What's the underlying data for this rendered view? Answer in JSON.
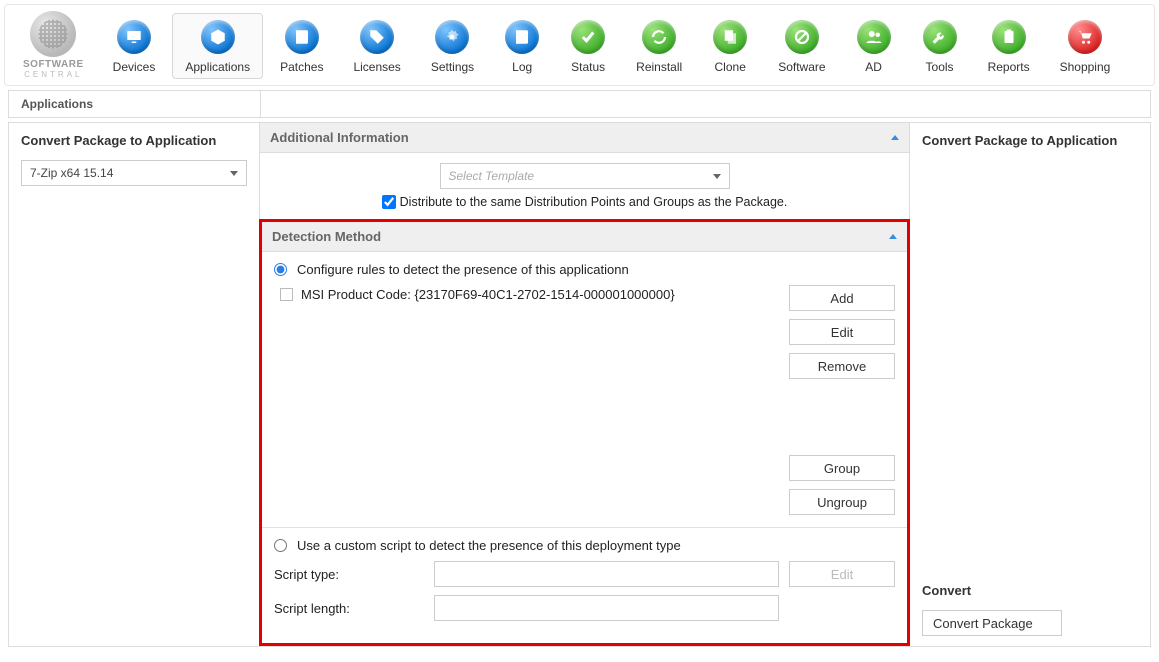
{
  "logo": {
    "brand": "SOFTWARE",
    "sub": "CENTRAL"
  },
  "toolbar": [
    {
      "id": "devices",
      "label": "Devices",
      "color": "blue",
      "glyph": "monitor"
    },
    {
      "id": "applications",
      "label": "Applications",
      "color": "blue",
      "glyph": "box",
      "active": true
    },
    {
      "id": "patches",
      "label": "Patches",
      "color": "blue",
      "glyph": "book"
    },
    {
      "id": "licenses",
      "label": "Licenses",
      "color": "blue",
      "glyph": "tag"
    },
    {
      "id": "settings",
      "label": "Settings",
      "color": "blue",
      "glyph": "gear"
    },
    {
      "id": "log",
      "label": "Log",
      "color": "blue",
      "glyph": "book"
    },
    {
      "id": "status",
      "label": "Status",
      "color": "green",
      "glyph": "check"
    },
    {
      "id": "reinstall",
      "label": "Reinstall",
      "color": "green",
      "glyph": "refresh"
    },
    {
      "id": "clone",
      "label": "Clone",
      "color": "green",
      "glyph": "copy"
    },
    {
      "id": "software",
      "label": "Software",
      "color": "green",
      "glyph": "slash"
    },
    {
      "id": "ad",
      "label": "AD",
      "color": "green",
      "glyph": "users"
    },
    {
      "id": "tools",
      "label": "Tools",
      "color": "green",
      "glyph": "wrench"
    },
    {
      "id": "reports",
      "label": "Reports",
      "color": "green",
      "glyph": "clip"
    },
    {
      "id": "shopping",
      "label": "Shopping",
      "color": "red",
      "glyph": "cart"
    }
  ],
  "breadcrumb": "Applications",
  "left": {
    "title": "Convert Package to Application",
    "package": "7-Zip x64 15.14"
  },
  "mid": {
    "additional": {
      "title": "Additional Information",
      "template_placeholder": "Select Template",
      "distribute": "Distribute to the same Distribution Points and Groups as the Package.",
      "distribute_checked": true
    },
    "detection": {
      "title": "Detection Method",
      "opt_rules": "Configure rules to detect the presence of this applicationn",
      "rules": [
        "MSI Product Code: {23170F69-40C1-2702-1514-000001000000}"
      ],
      "btn_add": "Add",
      "btn_edit": "Edit",
      "btn_remove": "Remove",
      "btn_group": "Group",
      "btn_ungroup": "Ungroup",
      "opt_script": "Use a custom script to detect the presence of this deployment type",
      "script_type_label": "Script type:",
      "script_type": "",
      "script_length_label": "Script length:",
      "script_length": "",
      "btn_edit_script": "Edit"
    }
  },
  "right": {
    "title": "Convert Package to Application",
    "convert_title": "Convert",
    "convert_btn": "Convert Package"
  }
}
